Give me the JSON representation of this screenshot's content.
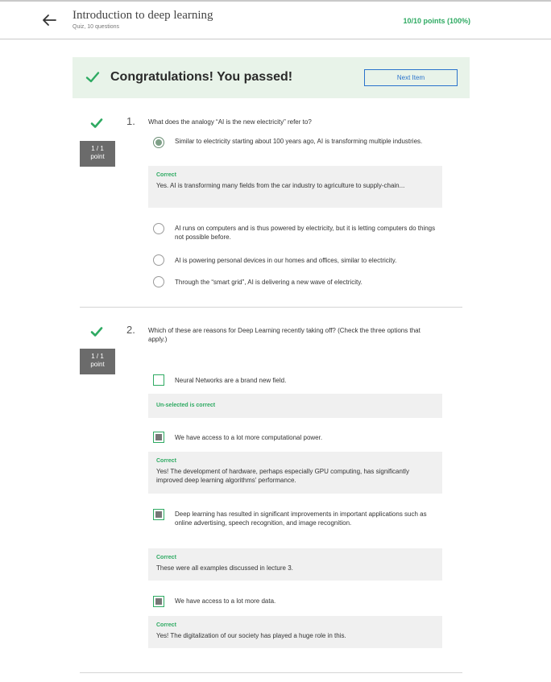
{
  "header": {
    "title": "Introduction to deep learning",
    "subtitle": "Quiz, 10 questions",
    "score": "10/10 points (100%)"
  },
  "banner": {
    "message": "Congratulations! You passed!",
    "next_label": "Next Item"
  },
  "questions": [
    {
      "number": "1.",
      "points_top": "1 / 1",
      "points_bottom": "point",
      "text": "What does the analogy “AI is the new electricity” refer to?",
      "options": [
        {
          "text": "Similar to electricity starting about 100 years ago, AI is transforming multiple industries.",
          "selected": true,
          "feedback_title": "Correct",
          "feedback_text": "Yes. AI is transforming many fields from the car industry to agriculture to supply-chain..."
        },
        {
          "text": "AI runs on computers and is thus powered by electricity, but it is letting computers do things not possible before.",
          "selected": false
        },
        {
          "text": "AI is powering personal devices in our homes and offices, similar to electricity.",
          "selected": false
        },
        {
          "text": "Through the “smart grid”, AI is delivering a new wave of electricity.",
          "selected": false
        }
      ]
    },
    {
      "number": "2.",
      "points_top": "1 / 1",
      "points_bottom": "point",
      "text": "Which of these are reasons for Deep Learning recently taking off? (Check the three options that apply.)",
      "options": [
        {
          "text": "Neural Networks are a brand new field.",
          "selected": false,
          "feedback_title": "Un-selected is correct",
          "feedback_text": ""
        },
        {
          "text": "We have access to a lot more computational power.",
          "selected": true,
          "feedback_title": "Correct",
          "feedback_text": "Yes! The development of hardware, perhaps especially GPU computing, has significantly improved deep learning algorithms' performance."
        },
        {
          "text": "Deep learning has resulted in significant improvements in important applications such as online advertising, speech recognition, and image recognition.",
          "selected": true,
          "feedback_title": "Correct",
          "feedback_text": "These were all examples discussed in lecture 3."
        },
        {
          "text": "We have access to a lot more data.",
          "selected": true,
          "feedback_title": "Correct",
          "feedback_text": "Yes! The digitalization of our society has played a huge role in this."
        }
      ]
    }
  ],
  "colors": {
    "accent_green": "#2eaa62",
    "banner_bg": "#e8f3e9",
    "link_blue": "#2a73cc"
  },
  "icons": {
    "back": "arrow-left-icon",
    "check": "checkmark-icon"
  }
}
